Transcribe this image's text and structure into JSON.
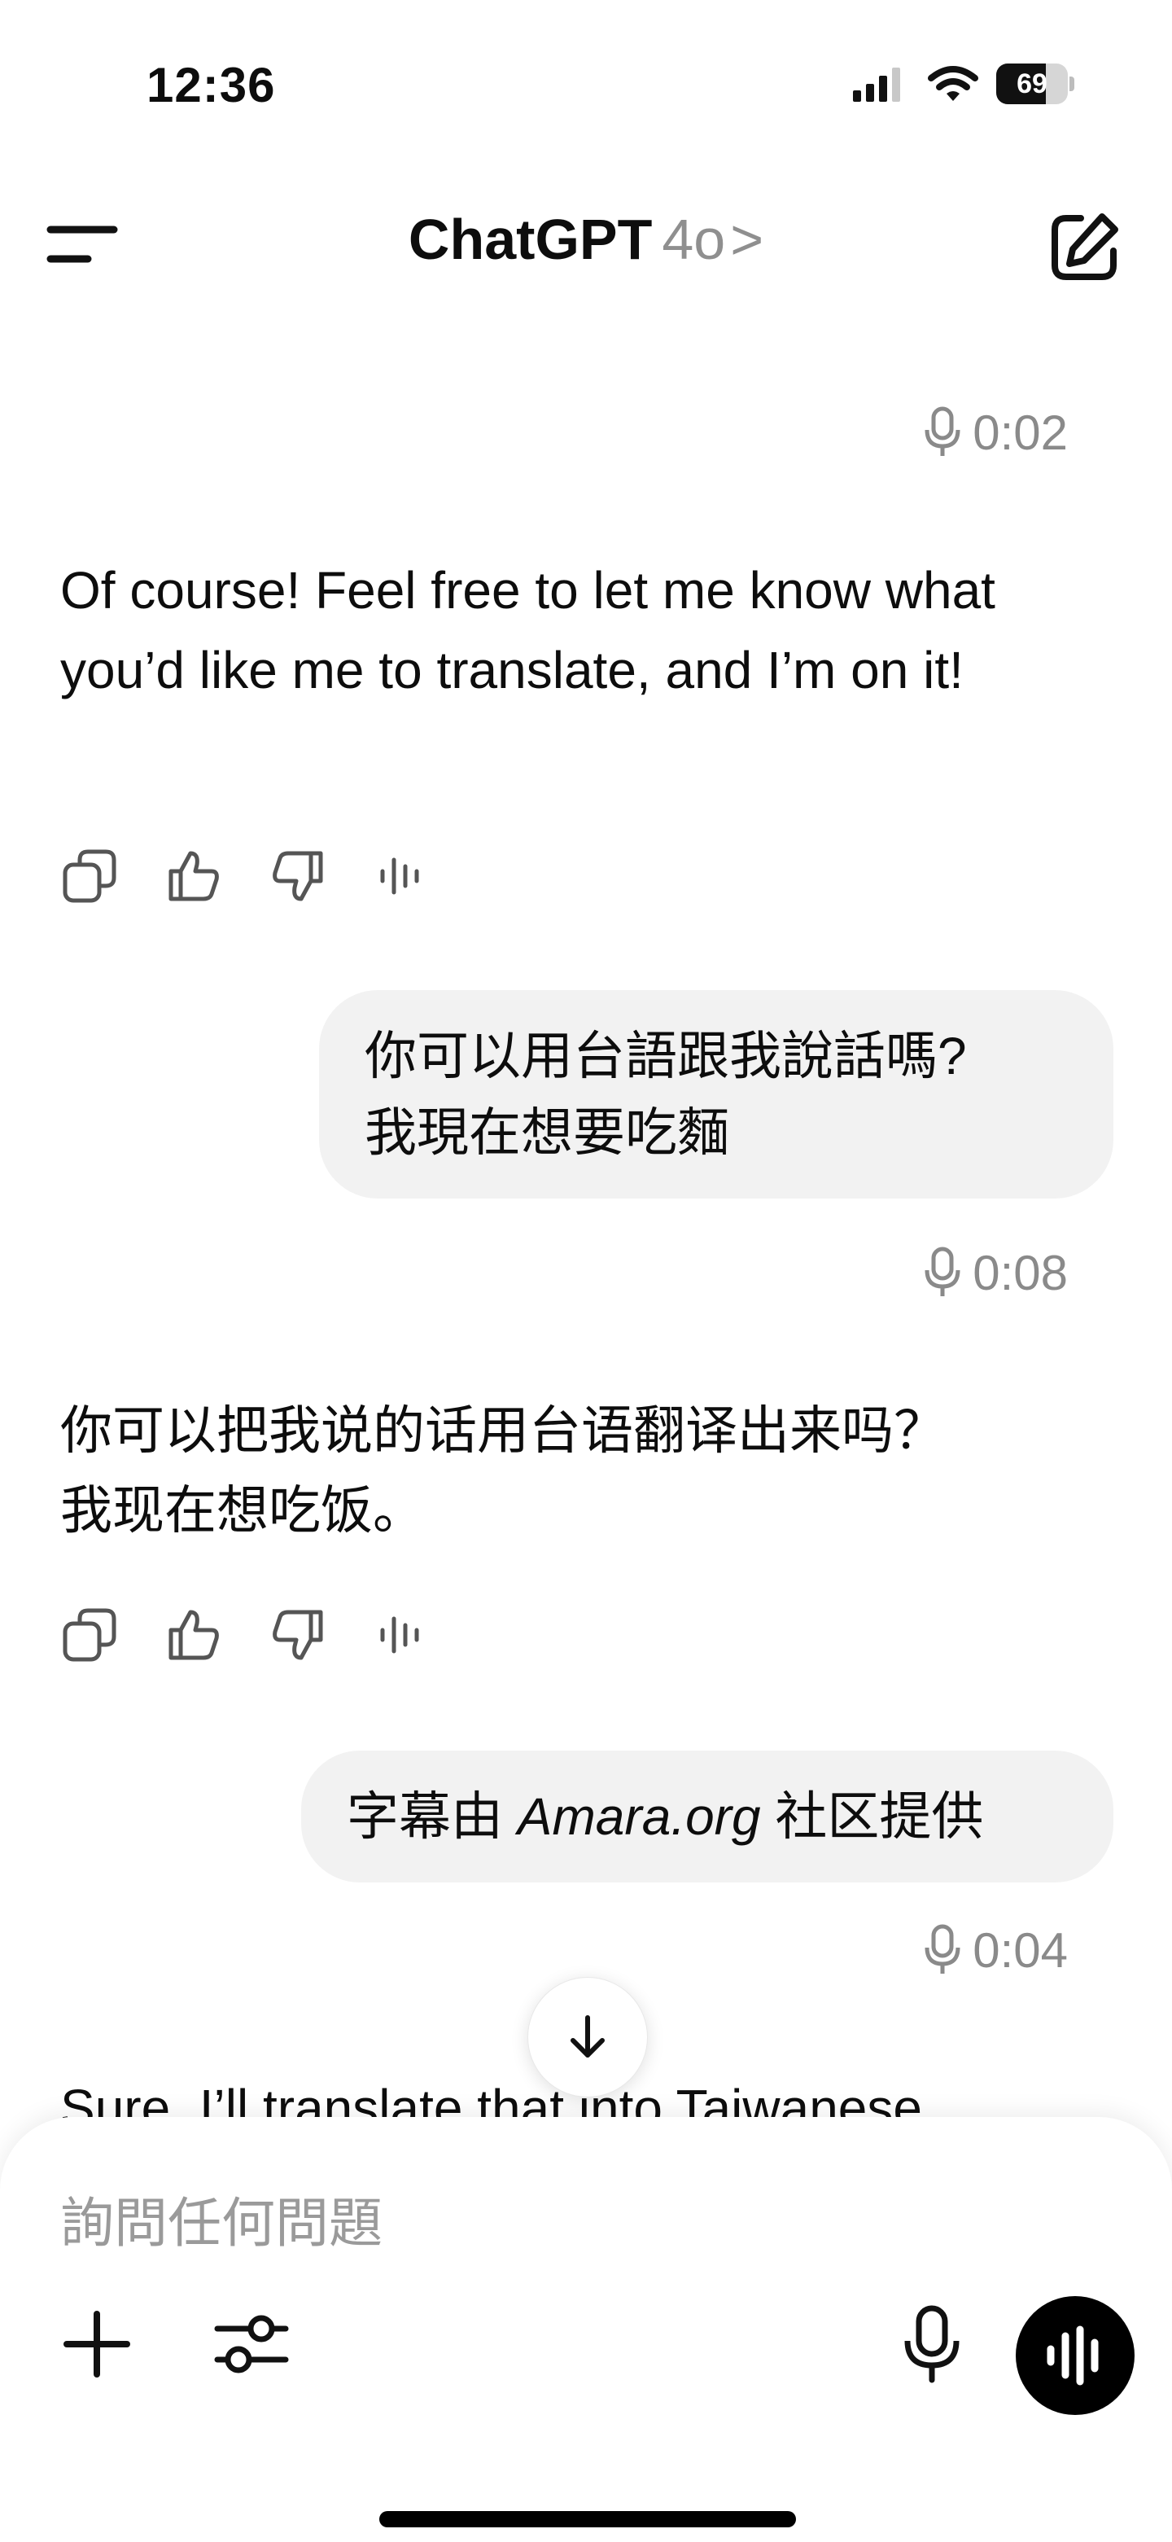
{
  "status_bar": {
    "time": "12:36",
    "battery": "69",
    "battery_level": 0.69
  },
  "header": {
    "title": "ChatGPT",
    "model": "4o",
    "chevron": ">"
  },
  "messages": {
    "m1_timestamp": "0:02",
    "m2_text": "Of course! Feel free to let me know what you’d like me to translate, and I’m on it!",
    "m3_line1": "你可以用台語跟我說話嗎?",
    "m3_line2": "我現在想要吃麵",
    "m3_timestamp": "0:08",
    "m4_line1": "你可以把我说的话用台语翻译出来吗？",
    "m4_line2": "我现在想吃饭。",
    "m5_prefix": "字幕由 ",
    "m5_italic": "Amara.org",
    "m5_suffix": " 社区提供",
    "m5_timestamp": "0:04",
    "m6_partial": "Sure, I’ll translate that into Taiwanese"
  },
  "composer": {
    "placeholder": "詢問任何問題"
  },
  "icons": {
    "menu": "menu-icon",
    "new_chat": "edit-icon",
    "mic": "mic-icon",
    "copy": "copy-icon",
    "thumb_up": "thumbs-up-icon",
    "thumb_down": "thumbs-down-icon",
    "read_aloud": "audio-wave-icon",
    "scroll": "arrow-down-icon",
    "plus": "plus-icon",
    "tools": "sliders-icon",
    "voice": "voice-mode-icon"
  }
}
